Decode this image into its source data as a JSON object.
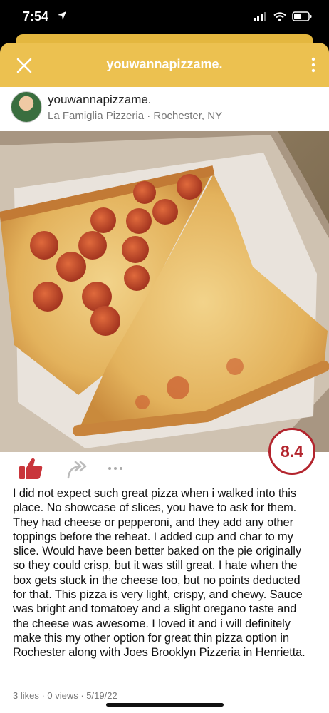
{
  "status_bar": {
    "time": "7:54"
  },
  "header": {
    "title": "youwannapizzame."
  },
  "post": {
    "username": "youwannapizzame.",
    "location": "La Famiglia Pizzeria · Rochester, NY",
    "rating": "8.4",
    "review_text": "I did not expect such great pizza when i walked into this place. No showcase of slices, you have to ask for them. They had cheese or pepperoni, and they add any other toppings before the reheat. I added cup and char to my slice. Would have been better baked on the pie originally so they could crisp, but it was still great. I hate when the box gets stuck in the cheese too, but no points deducted for that. This pizza is very light, crispy, and chewy. Sauce was bright and tomatoey and a slight oregano taste and the cheese was awesome. I loved it and i will definitely make this my other option for great thin pizza option in Rochester along with Joes Brooklyn Pizzeria in Henrietta.",
    "meta": "3 likes · 0 views · 5/19/22"
  },
  "colors": {
    "header_bg": "#ecc150",
    "rating_red": "#b3242d",
    "like_red": "#c9353b"
  },
  "icons": [
    "location-arrow-icon",
    "signal-icon",
    "wifi-icon",
    "battery-icon",
    "close-icon",
    "more-vertical-icon",
    "thumbs-up-icon",
    "share-arrow-icon",
    "more-horizontal-icon"
  ]
}
